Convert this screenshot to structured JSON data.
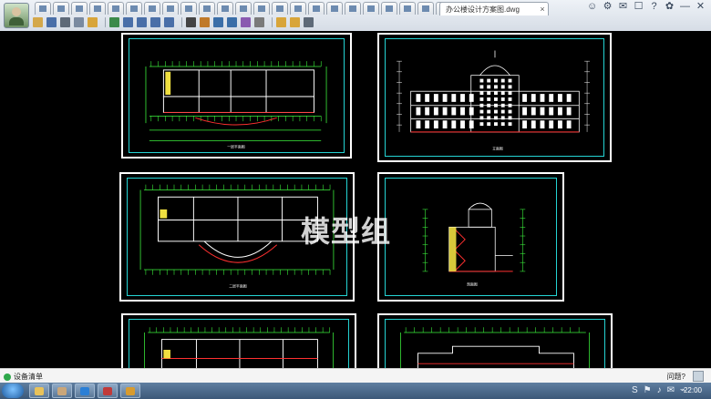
{
  "titlebar": {
    "file_tab_name": "办公楼设计方案图.dwg",
    "close_glyph": "×",
    "tab_icons": [
      "tab-1",
      "tab-2",
      "tab-3",
      "tab-4",
      "tab-5",
      "tab-6",
      "tab-7",
      "tab-8",
      "tab-9",
      "tab-10",
      "tab-11",
      "tab-12",
      "tab-13",
      "tab-14",
      "tab-15",
      "tab-16",
      "tab-17",
      "tab-18",
      "tab-19",
      "tab-20",
      "tab-21",
      "tab-22",
      "tab-23",
      "tab-24"
    ],
    "system_icons": [
      "user-icon",
      "settings-icon",
      "chat-icon",
      "mail-icon",
      "help-icon",
      "gear-icon",
      "minimize-icon",
      "close-icon"
    ],
    "system_glyphs": [
      "☺",
      "⚙",
      "✉",
      "☐",
      "?",
      "✿",
      "—",
      "✕"
    ]
  },
  "toolbar": {
    "buttons": [
      {
        "name": "open-file-icon",
        "color": "#d4a84a"
      },
      {
        "name": "save-icon",
        "color": "#4a6fa8"
      },
      {
        "name": "print-icon",
        "color": "#5e6a78"
      },
      {
        "name": "copy-icon",
        "color": "#7a8aa0"
      },
      {
        "name": "lock-icon",
        "color": "#d8a53a"
      },
      {
        "name": "separator"
      },
      {
        "name": "refresh-icon",
        "color": "#3c8a4a"
      },
      {
        "name": "pan-icon",
        "color": "#4a6fa8"
      },
      {
        "name": "zoom-in-icon",
        "color": "#4a6fa8"
      },
      {
        "name": "zoom-out-icon",
        "color": "#4a6fa8"
      },
      {
        "name": "zoom-window-icon",
        "color": "#4a6fa8"
      },
      {
        "name": "separator"
      },
      {
        "name": "text-icon",
        "color": "#444444"
      },
      {
        "name": "pencil-icon",
        "color": "#c07a2a"
      },
      {
        "name": "line-icon",
        "color": "#3a6ea8"
      },
      {
        "name": "measure-icon",
        "color": "#3a6ea8"
      },
      {
        "name": "erase-icon",
        "color": "#8a5ab0"
      },
      {
        "name": "ruler-icon",
        "color": "#7a7a7a"
      },
      {
        "name": "separator"
      },
      {
        "name": "layer-icon",
        "color": "#d8a53a"
      },
      {
        "name": "layout-icon",
        "color": "#d8a53a"
      },
      {
        "name": "fullscreen-icon",
        "color": "#5e6a78"
      }
    ]
  },
  "canvas": {
    "watermark": "模型组",
    "drawings": [
      {
        "name": "floor-plan-1",
        "caption": "一层平面图"
      },
      {
        "name": "front-elevation",
        "caption": "立面图"
      },
      {
        "name": "floor-plan-2",
        "caption": "二层平面图"
      },
      {
        "name": "section-view",
        "caption": "剖面图"
      },
      {
        "name": "floor-plan-3",
        "caption": ""
      },
      {
        "name": "side-elevation",
        "caption": ""
      }
    ]
  },
  "statusbar": {
    "label": "设备清单",
    "help": "问题?"
  },
  "taskbar": {
    "items": [
      {
        "name": "taskbar-explorer",
        "color": "#e8c25a"
      },
      {
        "name": "taskbar-avatar",
        "color": "#c9a67a"
      },
      {
        "name": "taskbar-browser",
        "color": "#2b7fd6"
      },
      {
        "name": "taskbar-app-cad",
        "color": "#c03a3a"
      },
      {
        "name": "taskbar-app-viewer",
        "color": "#d89b2e"
      }
    ],
    "tray_glyphs": [
      "S",
      "⚑",
      "♪",
      "✉",
      "⌁"
    ],
    "clock": "22:00"
  },
  "colors": {
    "cad_background": "#000000",
    "frame_cyan": "#24d4d4",
    "drawing_green": "#3cf03c",
    "drawing_white": "#ffffff",
    "drawing_red": "#ff3030",
    "drawing_yellow": "#f0e040"
  }
}
